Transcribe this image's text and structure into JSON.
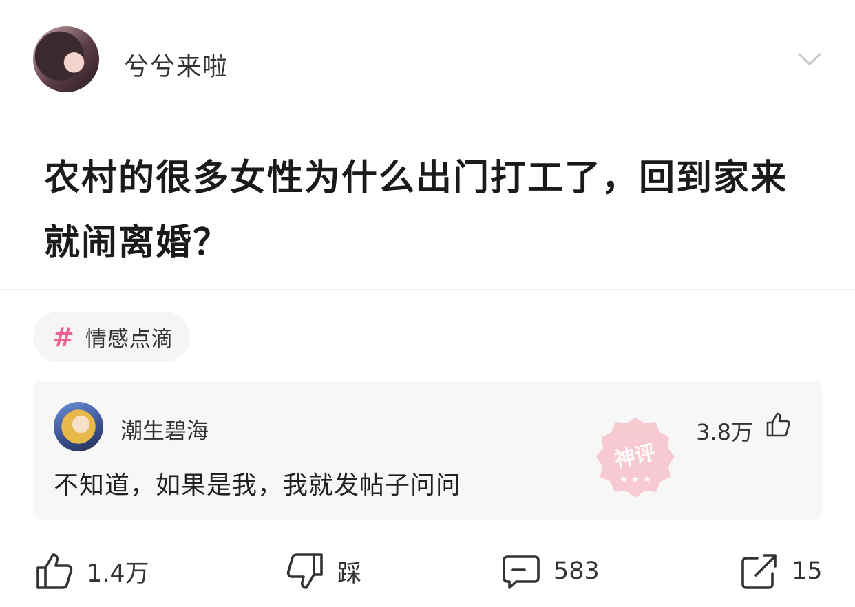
{
  "header": {
    "author_name": "兮兮来啦"
  },
  "post": {
    "title": "农村的很多女性为什么出门打工了，回到家来就闹离婚？",
    "tag": "情感点滴"
  },
  "top_comment": {
    "user_name": "潮生碧海",
    "likes": "3.8万",
    "text": "不知道，如果是我，我就发帖子问问",
    "stamp_text": "神评"
  },
  "actions": {
    "like_count": "1.4万",
    "dislike_label": "踩",
    "comment_count": "583",
    "share_count": "15"
  },
  "colors": {
    "tag_hash": "#f06292",
    "stamp": "#f8a5b5"
  },
  "icons": [
    "chevron-down-icon",
    "hash-icon",
    "thumbs-up-icon",
    "thumbs-down-icon",
    "comment-icon",
    "share-icon"
  ]
}
